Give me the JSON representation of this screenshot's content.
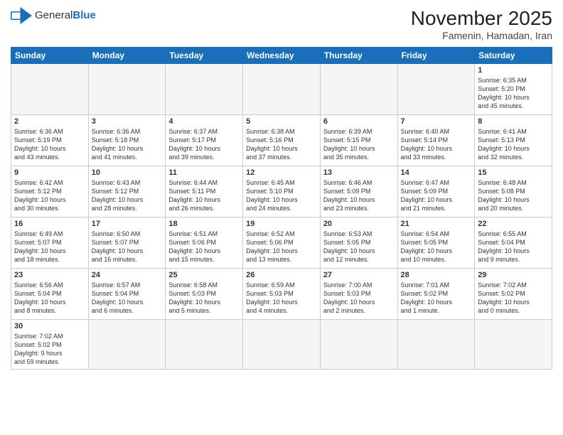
{
  "header": {
    "logo_general": "General",
    "logo_blue": "Blue",
    "month_title": "November 2025",
    "location": "Famenin, Hamadan, Iran"
  },
  "weekdays": [
    "Sunday",
    "Monday",
    "Tuesday",
    "Wednesday",
    "Thursday",
    "Friday",
    "Saturday"
  ],
  "weeks": [
    [
      {
        "day": "",
        "info": ""
      },
      {
        "day": "",
        "info": ""
      },
      {
        "day": "",
        "info": ""
      },
      {
        "day": "",
        "info": ""
      },
      {
        "day": "",
        "info": ""
      },
      {
        "day": "",
        "info": ""
      },
      {
        "day": "1",
        "info": "Sunrise: 6:35 AM\nSunset: 5:20 PM\nDaylight: 10 hours\nand 45 minutes."
      }
    ],
    [
      {
        "day": "2",
        "info": "Sunrise: 6:36 AM\nSunset: 5:19 PM\nDaylight: 10 hours\nand 43 minutes."
      },
      {
        "day": "3",
        "info": "Sunrise: 6:36 AM\nSunset: 5:18 PM\nDaylight: 10 hours\nand 41 minutes."
      },
      {
        "day": "4",
        "info": "Sunrise: 6:37 AM\nSunset: 5:17 PM\nDaylight: 10 hours\nand 39 minutes."
      },
      {
        "day": "5",
        "info": "Sunrise: 6:38 AM\nSunset: 5:16 PM\nDaylight: 10 hours\nand 37 minutes."
      },
      {
        "day": "6",
        "info": "Sunrise: 6:39 AM\nSunset: 5:15 PM\nDaylight: 10 hours\nand 35 minutes."
      },
      {
        "day": "7",
        "info": "Sunrise: 6:40 AM\nSunset: 5:14 PM\nDaylight: 10 hours\nand 33 minutes."
      },
      {
        "day": "8",
        "info": "Sunrise: 6:41 AM\nSunset: 5:13 PM\nDaylight: 10 hours\nand 32 minutes."
      }
    ],
    [
      {
        "day": "9",
        "info": "Sunrise: 6:42 AM\nSunset: 5:12 PM\nDaylight: 10 hours\nand 30 minutes."
      },
      {
        "day": "10",
        "info": "Sunrise: 6:43 AM\nSunset: 5:12 PM\nDaylight: 10 hours\nand 28 minutes."
      },
      {
        "day": "11",
        "info": "Sunrise: 6:44 AM\nSunset: 5:11 PM\nDaylight: 10 hours\nand 26 minutes."
      },
      {
        "day": "12",
        "info": "Sunrise: 6:45 AM\nSunset: 5:10 PM\nDaylight: 10 hours\nand 24 minutes."
      },
      {
        "day": "13",
        "info": "Sunrise: 6:46 AM\nSunset: 5:09 PM\nDaylight: 10 hours\nand 23 minutes."
      },
      {
        "day": "14",
        "info": "Sunrise: 6:47 AM\nSunset: 5:09 PM\nDaylight: 10 hours\nand 21 minutes."
      },
      {
        "day": "15",
        "info": "Sunrise: 6:48 AM\nSunset: 5:08 PM\nDaylight: 10 hours\nand 20 minutes."
      }
    ],
    [
      {
        "day": "16",
        "info": "Sunrise: 6:49 AM\nSunset: 5:07 PM\nDaylight: 10 hours\nand 18 minutes."
      },
      {
        "day": "17",
        "info": "Sunrise: 6:50 AM\nSunset: 5:07 PM\nDaylight: 10 hours\nand 16 minutes."
      },
      {
        "day": "18",
        "info": "Sunrise: 6:51 AM\nSunset: 5:06 PM\nDaylight: 10 hours\nand 15 minutes."
      },
      {
        "day": "19",
        "info": "Sunrise: 6:52 AM\nSunset: 5:06 PM\nDaylight: 10 hours\nand 13 minutes."
      },
      {
        "day": "20",
        "info": "Sunrise: 6:53 AM\nSunset: 5:05 PM\nDaylight: 10 hours\nand 12 minutes."
      },
      {
        "day": "21",
        "info": "Sunrise: 6:54 AM\nSunset: 5:05 PM\nDaylight: 10 hours\nand 10 minutes."
      },
      {
        "day": "22",
        "info": "Sunrise: 6:55 AM\nSunset: 5:04 PM\nDaylight: 10 hours\nand 9 minutes."
      }
    ],
    [
      {
        "day": "23",
        "info": "Sunrise: 6:56 AM\nSunset: 5:04 PM\nDaylight: 10 hours\nand 8 minutes."
      },
      {
        "day": "24",
        "info": "Sunrise: 6:57 AM\nSunset: 5:04 PM\nDaylight: 10 hours\nand 6 minutes."
      },
      {
        "day": "25",
        "info": "Sunrise: 6:58 AM\nSunset: 5:03 PM\nDaylight: 10 hours\nand 5 minutes."
      },
      {
        "day": "26",
        "info": "Sunrise: 6:59 AM\nSunset: 5:03 PM\nDaylight: 10 hours\nand 4 minutes."
      },
      {
        "day": "27",
        "info": "Sunrise: 7:00 AM\nSunset: 5:03 PM\nDaylight: 10 hours\nand 2 minutes."
      },
      {
        "day": "28",
        "info": "Sunrise: 7:01 AM\nSunset: 5:02 PM\nDaylight: 10 hours\nand 1 minute."
      },
      {
        "day": "29",
        "info": "Sunrise: 7:02 AM\nSunset: 5:02 PM\nDaylight: 10 hours\nand 0 minutes."
      }
    ],
    [
      {
        "day": "30",
        "info": "Sunrise: 7:02 AM\nSunset: 5:02 PM\nDaylight: 9 hours\nand 59 minutes."
      },
      {
        "day": "",
        "info": ""
      },
      {
        "day": "",
        "info": ""
      },
      {
        "day": "",
        "info": ""
      },
      {
        "day": "",
        "info": ""
      },
      {
        "day": "",
        "info": ""
      },
      {
        "day": "",
        "info": ""
      }
    ]
  ]
}
